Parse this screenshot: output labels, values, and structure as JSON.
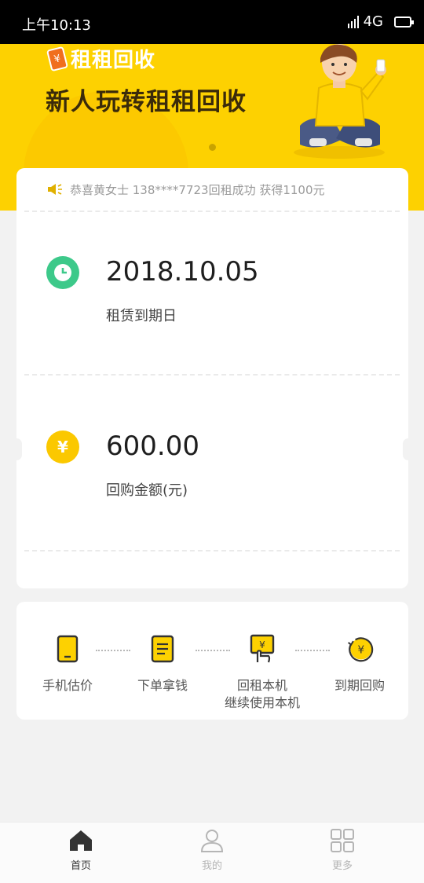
{
  "status_bar": {
    "time": "上午10:13",
    "network": "4G"
  },
  "banner": {
    "logo_text": "租租回收",
    "logo_icon": "phone-yen-icon",
    "title": "新人玩转租租回收"
  },
  "notice": {
    "text": "恭喜黄女士 138****7723回租成功 获得1100元",
    "icon": "speaker-icon"
  },
  "lease": {
    "date_value": "2018.10.05",
    "date_label": "租赁到期日",
    "amount_value": "600.00",
    "amount_label": "回购金额(元)"
  },
  "steps": [
    {
      "label": "手机估价",
      "icon": "phone-icon"
    },
    {
      "label": "下单拿钱",
      "icon": "document-icon"
    },
    {
      "label": "回租本机\n继续使用本机",
      "icon": "hand-phone-icon"
    },
    {
      "label": "到期回购",
      "icon": "yen-refresh-icon"
    }
  ],
  "tabs": [
    {
      "label": "首页",
      "icon": "home-icon",
      "active": true
    },
    {
      "label": "我的",
      "icon": "user-icon",
      "active": false
    },
    {
      "label": "更多",
      "icon": "grid-icon",
      "active": false
    }
  ],
  "colors": {
    "brand_yellow": "#fdd101",
    "clock_green": "#3dc98a",
    "coin_yellow": "#fbc800",
    "tab_active": "#333333",
    "tab_inactive": "#b5b5b5"
  }
}
